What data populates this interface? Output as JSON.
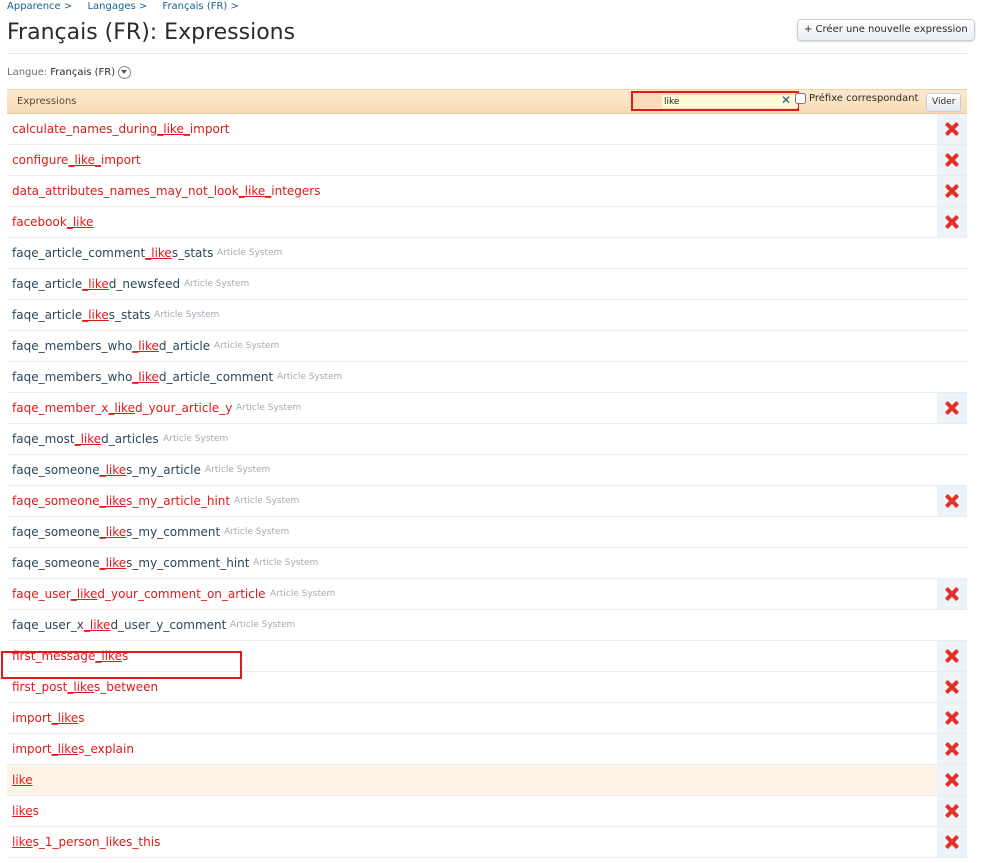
{
  "breadcrumb": [
    "Apparence >",
    "Langages >",
    "Français (FR) >"
  ],
  "page_title": "Français (FR): Expressions",
  "create_button": "+ Créer une nouvelle expression",
  "language": {
    "label": "Langue:",
    "value": "Français (FR)"
  },
  "list_header": {
    "title": "Expressions",
    "filter_value": "like",
    "prefix_label": "Préfixe correspondant",
    "prefix_checked": false,
    "clear_button": "Vider"
  },
  "colors": {
    "custom_phrase": "#e21919",
    "default_phrase": "#2b485c",
    "header_bg": "#fde9cf",
    "delete_icon": "#e3302a"
  },
  "phrases": [
    {
      "pre": "calculate_names_during",
      "match": "_like_",
      "post": "import",
      "addon": "",
      "custom": true,
      "deletable": true
    },
    {
      "pre": "configure",
      "match": "_like_",
      "post": "import",
      "addon": "",
      "custom": true,
      "deletable": true
    },
    {
      "pre": "data_attributes_names_may_not_look",
      "match": "_like_",
      "post": "integers",
      "addon": "",
      "custom": true,
      "deletable": true
    },
    {
      "pre": "facebook",
      "match": "_like",
      "post": "",
      "addon": "",
      "custom": true,
      "deletable": true
    },
    {
      "pre": "faqe_article_comment",
      "match": "_like",
      "post": "s_stats",
      "addon": "Article System",
      "custom": false,
      "deletable": false
    },
    {
      "pre": "faqe_article",
      "match": "_like",
      "post": "d_newsfeed",
      "addon": "Article System",
      "custom": false,
      "deletable": false
    },
    {
      "pre": "faqe_article",
      "match": "_like",
      "post": "s_stats",
      "addon": "Article System",
      "custom": false,
      "deletable": false
    },
    {
      "pre": "faqe_members_who",
      "match": "_like",
      "post": "d_article",
      "addon": "Article System",
      "custom": false,
      "deletable": false
    },
    {
      "pre": "faqe_members_who",
      "match": "_like",
      "post": "d_article_comment",
      "addon": "Article System",
      "custom": false,
      "deletable": false
    },
    {
      "pre": "faqe_member_x",
      "match": "_like",
      "post": "d_your_article_y",
      "addon": "Article System",
      "custom": true,
      "deletable": true
    },
    {
      "pre": "faqe_most",
      "match": "_like",
      "post": "d_articles",
      "addon": "Article System",
      "custom": false,
      "deletable": false
    },
    {
      "pre": "faqe_someone",
      "match": "_like",
      "post": "s_my_article",
      "addon": "Article System",
      "custom": false,
      "deletable": false
    },
    {
      "pre": "faqe_someone",
      "match": "_like",
      "post": "s_my_article_hint",
      "addon": "Article System",
      "custom": true,
      "deletable": true
    },
    {
      "pre": "faqe_someone",
      "match": "_like",
      "post": "s_my_comment",
      "addon": "Article System",
      "custom": false,
      "deletable": false
    },
    {
      "pre": "faqe_someone",
      "match": "_like",
      "post": "s_my_comment_hint",
      "addon": "Article System",
      "custom": false,
      "deletable": false
    },
    {
      "pre": "faqe_user",
      "match": "_like",
      "post": "d_your_comment_on_article",
      "addon": "Article System",
      "custom": true,
      "deletable": true
    },
    {
      "pre": "faqe_user_x",
      "match": "_like",
      "post": "d_user_y_comment",
      "addon": "Article System",
      "custom": false,
      "deletable": false
    },
    {
      "pre": "first_message",
      "match": "_like",
      "post": "s",
      "addon": "",
      "custom": true,
      "deletable": true
    },
    {
      "pre": "first_post",
      "match": "_like",
      "post": "s_between",
      "addon": "",
      "custom": true,
      "deletable": true
    },
    {
      "pre": "import",
      "match": "_like",
      "post": "s",
      "addon": "",
      "custom": true,
      "deletable": true
    },
    {
      "pre": "import",
      "match": "_like",
      "post": "s_explain",
      "addon": "",
      "custom": true,
      "deletable": true
    },
    {
      "pre": "",
      "match": "like",
      "post": "",
      "addon": "",
      "custom": true,
      "deletable": true,
      "highlight": true
    },
    {
      "pre": "",
      "match": "like",
      "post": "s",
      "addon": "",
      "custom": true,
      "deletable": true
    },
    {
      "pre": "",
      "match": "like",
      "post": "s_1_person_likes_this",
      "addon": "",
      "custom": true,
      "deletable": true
    }
  ]
}
